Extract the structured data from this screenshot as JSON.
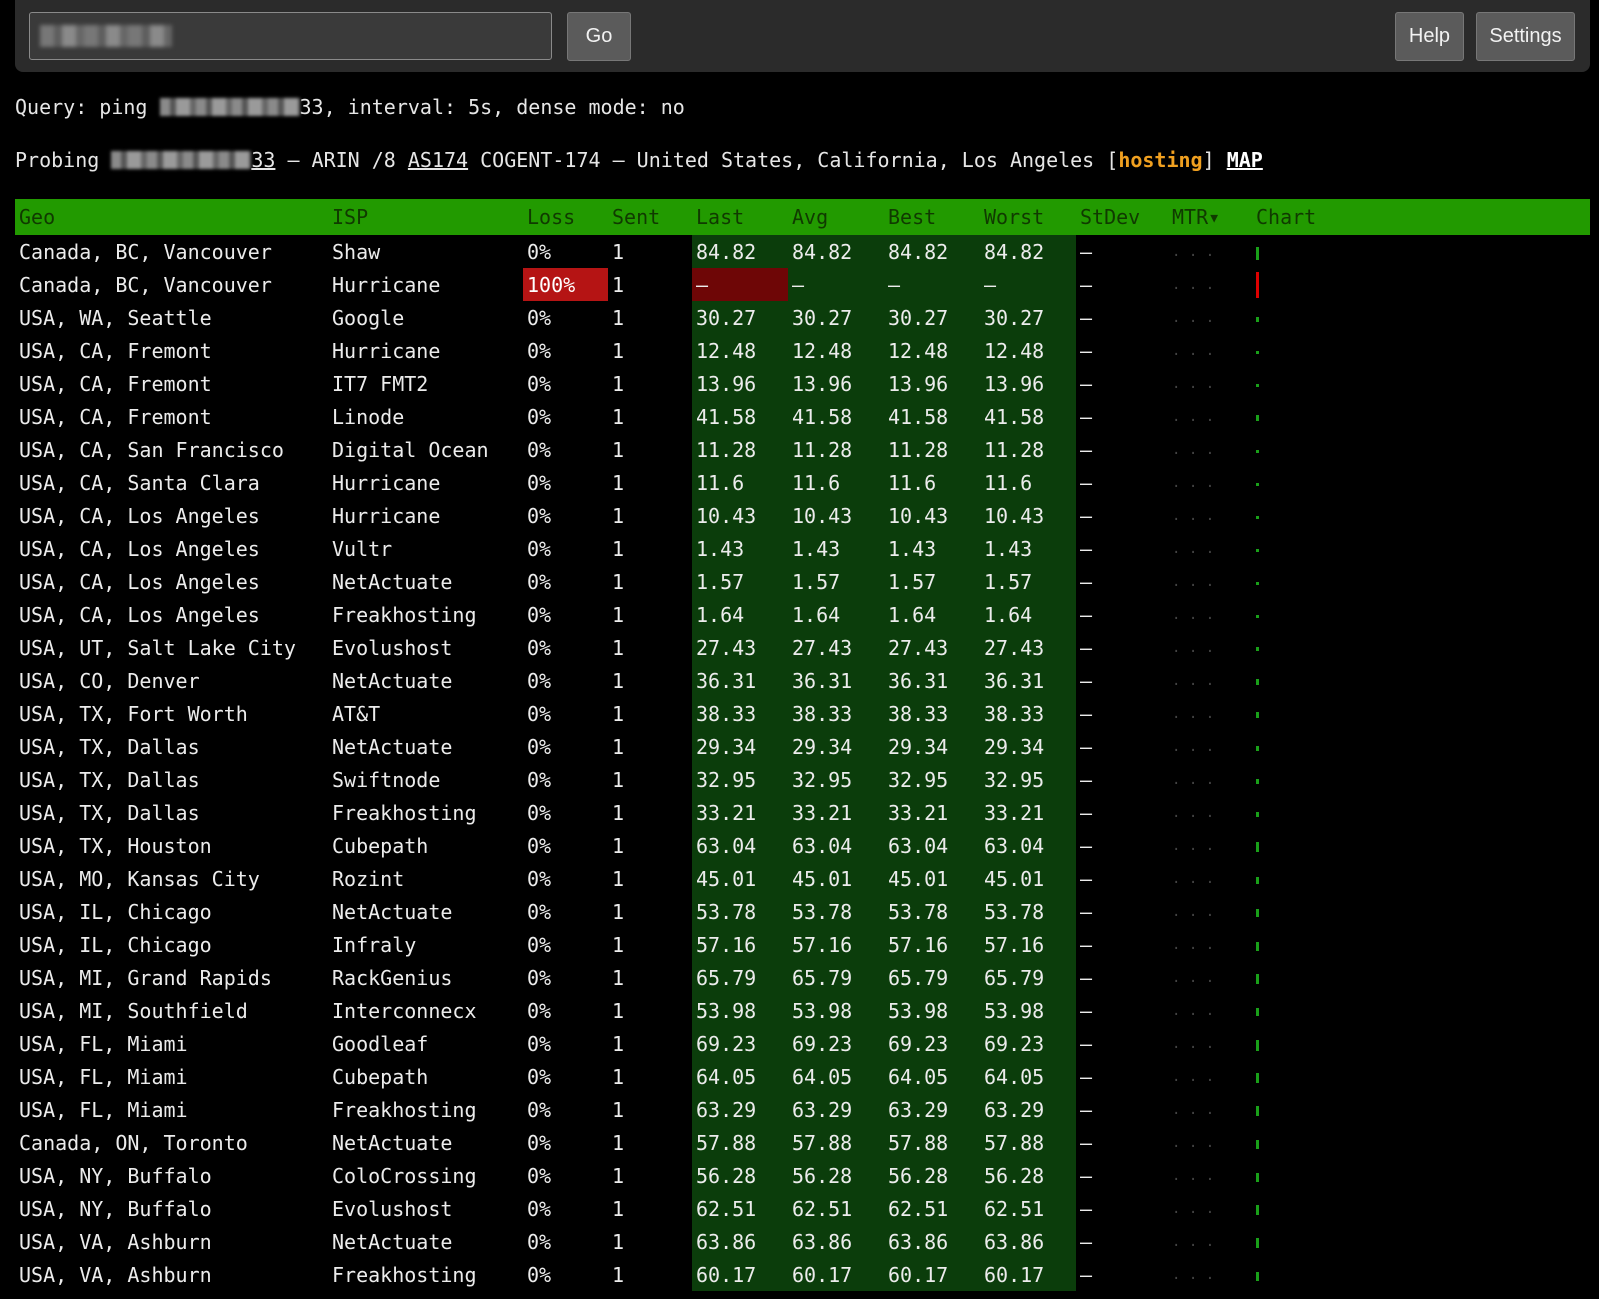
{
  "search": {
    "value": "",
    "placeholder": ""
  },
  "buttons": {
    "go": "Go",
    "help": "Help",
    "settings": "Settings"
  },
  "query": {
    "prefix": "Query: ping ",
    "ip_suffix": "33",
    "rest": ", interval: 5s, dense mode: no"
  },
  "probe": {
    "prefix": "Probing ",
    "ip_suffix": "33",
    "rir": " — ARIN /8 ",
    "asn": "AS174",
    "org_location": " COGENT-174 — United States, California, Los Angeles [",
    "tag": "hosting",
    "close": "] ",
    "map": "MAP"
  },
  "table": {
    "headers": {
      "geo": "Geo",
      "isp": "ISP",
      "loss": "Loss",
      "sent": "Sent",
      "last": "Last",
      "avg": "Avg",
      "best": "Best",
      "worst": "Worst",
      "stdev": "StDev",
      "mtr": "MTR▾",
      "chart": "Chart"
    },
    "rows": [
      {
        "geo": "Canada, BC, Vancouver",
        "isp": "Shaw",
        "loss": "0%",
        "sent": "1",
        "last": "84.82",
        "avg": "84.82",
        "best": "84.82",
        "worst": "84.82",
        "stdev": "—",
        "mtr": ". . ."
      },
      {
        "geo": "Canada, BC, Vancouver",
        "isp": "Hurricane",
        "loss": "100%",
        "sent": "1",
        "last": "—",
        "avg": "—",
        "best": "—",
        "worst": "—",
        "stdev": "—",
        "mtr": ". . ."
      },
      {
        "geo": "USA, WA, Seattle",
        "isp": "Google",
        "loss": "0%",
        "sent": "1",
        "last": "30.27",
        "avg": "30.27",
        "best": "30.27",
        "worst": "30.27",
        "stdev": "—",
        "mtr": ". . ."
      },
      {
        "geo": "USA, CA, Fremont",
        "isp": "Hurricane",
        "loss": "0%",
        "sent": "1",
        "last": "12.48",
        "avg": "12.48",
        "best": "12.48",
        "worst": "12.48",
        "stdev": "—",
        "mtr": ". . ."
      },
      {
        "geo": "USA, CA, Fremont",
        "isp": "IT7 FMT2",
        "loss": "0%",
        "sent": "1",
        "last": "13.96",
        "avg": "13.96",
        "best": "13.96",
        "worst": "13.96",
        "stdev": "—",
        "mtr": ". . ."
      },
      {
        "geo": "USA, CA, Fremont",
        "isp": "Linode",
        "loss": "0%",
        "sent": "1",
        "last": "41.58",
        "avg": "41.58",
        "best": "41.58",
        "worst": "41.58",
        "stdev": "—",
        "mtr": ". . ."
      },
      {
        "geo": "USA, CA, San Francisco",
        "isp": "Digital Ocean",
        "loss": "0%",
        "sent": "1",
        "last": "11.28",
        "avg": "11.28",
        "best": "11.28",
        "worst": "11.28",
        "stdev": "—",
        "mtr": ". . ."
      },
      {
        "geo": "USA, CA, Santa Clara",
        "isp": "Hurricane",
        "loss": "0%",
        "sent": "1",
        "last": "11.6",
        "avg": "11.6",
        "best": "11.6",
        "worst": "11.6",
        "stdev": "—",
        "mtr": ". . ."
      },
      {
        "geo": "USA, CA, Los Angeles",
        "isp": "Hurricane",
        "loss": "0%",
        "sent": "1",
        "last": "10.43",
        "avg": "10.43",
        "best": "10.43",
        "worst": "10.43",
        "stdev": "—",
        "mtr": ". . ."
      },
      {
        "geo": "USA, CA, Los Angeles",
        "isp": "Vultr",
        "loss": "0%",
        "sent": "1",
        "last": "1.43",
        "avg": "1.43",
        "best": "1.43",
        "worst": "1.43",
        "stdev": "—",
        "mtr": ". . ."
      },
      {
        "geo": "USA, CA, Los Angeles",
        "isp": "NetActuate",
        "loss": "0%",
        "sent": "1",
        "last": "1.57",
        "avg": "1.57",
        "best": "1.57",
        "worst": "1.57",
        "stdev": "—",
        "mtr": ". . ."
      },
      {
        "geo": "USA, CA, Los Angeles",
        "isp": "Freakhosting",
        "loss": "0%",
        "sent": "1",
        "last": "1.64",
        "avg": "1.64",
        "best": "1.64",
        "worst": "1.64",
        "stdev": "—",
        "mtr": ". . ."
      },
      {
        "geo": "USA, UT, Salt Lake City",
        "isp": "Evolushost",
        "loss": "0%",
        "sent": "1",
        "last": "27.43",
        "avg": "27.43",
        "best": "27.43",
        "worst": "27.43",
        "stdev": "—",
        "mtr": ". . ."
      },
      {
        "geo": "USA, CO, Denver",
        "isp": "NetActuate",
        "loss": "0%",
        "sent": "1",
        "last": "36.31",
        "avg": "36.31",
        "best": "36.31",
        "worst": "36.31",
        "stdev": "—",
        "mtr": ". . ."
      },
      {
        "geo": "USA, TX, Fort Worth",
        "isp": "AT&T",
        "loss": "0%",
        "sent": "1",
        "last": "38.33",
        "avg": "38.33",
        "best": "38.33",
        "worst": "38.33",
        "stdev": "—",
        "mtr": ". . ."
      },
      {
        "geo": "USA, TX, Dallas",
        "isp": "NetActuate",
        "loss": "0%",
        "sent": "1",
        "last": "29.34",
        "avg": "29.34",
        "best": "29.34",
        "worst": "29.34",
        "stdev": "—",
        "mtr": ". . ."
      },
      {
        "geo": "USA, TX, Dallas",
        "isp": "Swiftnode",
        "loss": "0%",
        "sent": "1",
        "last": "32.95",
        "avg": "32.95",
        "best": "32.95",
        "worst": "32.95",
        "stdev": "—",
        "mtr": ". . ."
      },
      {
        "geo": "USA, TX, Dallas",
        "isp": "Freakhosting",
        "loss": "0%",
        "sent": "1",
        "last": "33.21",
        "avg": "33.21",
        "best": "33.21",
        "worst": "33.21",
        "stdev": "—",
        "mtr": ". . ."
      },
      {
        "geo": "USA, TX, Houston",
        "isp": "Cubepath",
        "loss": "0%",
        "sent": "1",
        "last": "63.04",
        "avg": "63.04",
        "best": "63.04",
        "worst": "63.04",
        "stdev": "—",
        "mtr": ". . ."
      },
      {
        "geo": "USA, MO, Kansas City",
        "isp": "Rozint",
        "loss": "0%",
        "sent": "1",
        "last": "45.01",
        "avg": "45.01",
        "best": "45.01",
        "worst": "45.01",
        "stdev": "—",
        "mtr": ". . ."
      },
      {
        "geo": "USA, IL, Chicago",
        "isp": "NetActuate",
        "loss": "0%",
        "sent": "1",
        "last": "53.78",
        "avg": "53.78",
        "best": "53.78",
        "worst": "53.78",
        "stdev": "—",
        "mtr": ". . ."
      },
      {
        "geo": "USA, IL, Chicago",
        "isp": "Infraly",
        "loss": "0%",
        "sent": "1",
        "last": "57.16",
        "avg": "57.16",
        "best": "57.16",
        "worst": "57.16",
        "stdev": "—",
        "mtr": ". . ."
      },
      {
        "geo": "USA, MI, Grand Rapids",
        "isp": "RackGenius",
        "loss": "0%",
        "sent": "1",
        "last": "65.79",
        "avg": "65.79",
        "best": "65.79",
        "worst": "65.79",
        "stdev": "—",
        "mtr": ". . ."
      },
      {
        "geo": "USA, MI, Southfield",
        "isp": "Interconnecx",
        "loss": "0%",
        "sent": "1",
        "last": "53.98",
        "avg": "53.98",
        "best": "53.98",
        "worst": "53.98",
        "stdev": "—",
        "mtr": ". . ."
      },
      {
        "geo": "USA, FL, Miami",
        "isp": "Goodleaf",
        "loss": "0%",
        "sent": "1",
        "last": "69.23",
        "avg": "69.23",
        "best": "69.23",
        "worst": "69.23",
        "stdev": "—",
        "mtr": ". . ."
      },
      {
        "geo": "USA, FL, Miami",
        "isp": "Cubepath",
        "loss": "0%",
        "sent": "1",
        "last": "64.05",
        "avg": "64.05",
        "best": "64.05",
        "worst": "64.05",
        "stdev": "—",
        "mtr": ". . ."
      },
      {
        "geo": "USA, FL, Miami",
        "isp": "Freakhosting",
        "loss": "0%",
        "sent": "1",
        "last": "63.29",
        "avg": "63.29",
        "best": "63.29",
        "worst": "63.29",
        "stdev": "—",
        "mtr": ". . ."
      },
      {
        "geo": "Canada, ON, Toronto",
        "isp": "NetActuate",
        "loss": "0%",
        "sent": "1",
        "last": "57.88",
        "avg": "57.88",
        "best": "57.88",
        "worst": "57.88",
        "stdev": "—",
        "mtr": ". . ."
      },
      {
        "geo": "USA, NY, Buffalo",
        "isp": "ColoCrossing",
        "loss": "0%",
        "sent": "1",
        "last": "56.28",
        "avg": "56.28",
        "best": "56.28",
        "worst": "56.28",
        "stdev": "—",
        "mtr": ". . ."
      },
      {
        "geo": "USA, NY, Buffalo",
        "isp": "Evolushost",
        "loss": "0%",
        "sent": "1",
        "last": "62.51",
        "avg": "62.51",
        "best": "62.51",
        "worst": "62.51",
        "stdev": "—",
        "mtr": ". . ."
      },
      {
        "geo": "USA, VA, Ashburn",
        "isp": "NetActuate",
        "loss": "0%",
        "sent": "1",
        "last": "63.86",
        "avg": "63.86",
        "best": "63.86",
        "worst": "63.86",
        "stdev": "—",
        "mtr": ". . ."
      },
      {
        "geo": "USA, VA, Ashburn",
        "isp": "Freakhosting",
        "loss": "0%",
        "sent": "1",
        "last": "60.17",
        "avg": "60.17",
        "best": "60.17",
        "worst": "60.17",
        "stdev": "—",
        "mtr": ". . ."
      }
    ]
  },
  "colors": {
    "header_green": "#229a00",
    "stat_cell_green": "#0b3d0b",
    "loss_red": "#b51414",
    "hosting_tag": "#f0a020",
    "chart_ok": "#19a019",
    "chart_loss": "#dd0000"
  }
}
